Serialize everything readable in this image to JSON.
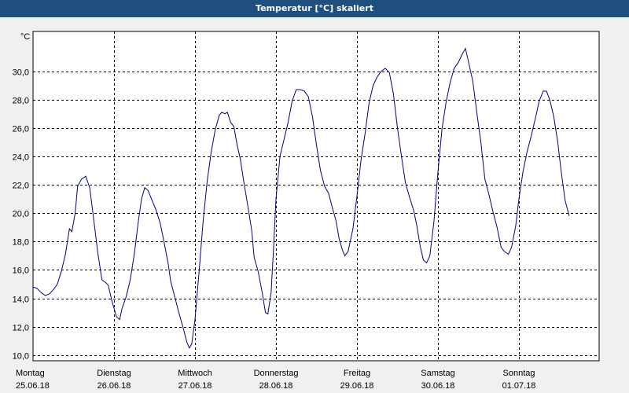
{
  "window": {
    "title": "Temperatur [°C] skaliert"
  },
  "chart_data": {
    "type": "line",
    "title": "Temperatur [°C] skaliert",
    "ylabel": "°C",
    "xlabel": "",
    "ylim": [
      9.6,
      32.8
    ],
    "yticks": [
      "10,0",
      "12,0",
      "14,0",
      "16,0",
      "18,0",
      "20,0",
      "22,0",
      "24,0",
      "26,0",
      "28,0",
      "30,0"
    ],
    "x_range_days": [
      0,
      7
    ],
    "x_categories": [
      {
        "day": "Montag",
        "date": "25.06.18"
      },
      {
        "day": "Dienstag",
        "date": "26.06.18"
      },
      {
        "day": "Mittwoch",
        "date": "27.06.18"
      },
      {
        "day": "Donnerstag",
        "date": "28.06.18"
      },
      {
        "day": "Freitag",
        "date": "29.06.18"
      },
      {
        "day": "Samstag",
        "date": "30.06.18"
      },
      {
        "day": "Sonntag",
        "date": "01.07.18"
      }
    ],
    "grid": true,
    "series": [
      {
        "color": "#00008b",
        "points": [
          [
            0.0,
            14.8
          ],
          [
            0.05,
            14.7
          ],
          [
            0.1,
            14.4
          ],
          [
            0.15,
            14.2
          ],
          [
            0.2,
            14.3
          ],
          [
            0.25,
            14.6
          ],
          [
            0.3,
            15.0
          ],
          [
            0.35,
            15.9
          ],
          [
            0.4,
            17.1
          ],
          [
            0.45,
            18.9
          ],
          [
            0.48,
            18.7
          ],
          [
            0.52,
            20.0
          ],
          [
            0.55,
            21.9
          ],
          [
            0.6,
            22.4
          ],
          [
            0.65,
            22.6
          ],
          [
            0.7,
            21.8
          ],
          [
            0.75,
            19.5
          ],
          [
            0.8,
            17.2
          ],
          [
            0.85,
            15.3
          ],
          [
            0.9,
            15.1
          ],
          [
            0.93,
            14.9
          ],
          [
            0.97,
            13.9
          ],
          [
            1.0,
            13.3
          ],
          [
            1.03,
            12.7
          ],
          [
            1.07,
            12.5
          ],
          [
            1.1,
            13.3
          ],
          [
            1.15,
            14.1
          ],
          [
            1.2,
            15.3
          ],
          [
            1.25,
            17.1
          ],
          [
            1.3,
            19.4
          ],
          [
            1.34,
            21.0
          ],
          [
            1.38,
            21.8
          ],
          [
            1.42,
            21.6
          ],
          [
            1.47,
            20.9
          ],
          [
            1.52,
            20.2
          ],
          [
            1.57,
            19.3
          ],
          [
            1.62,
            17.9
          ],
          [
            1.67,
            16.4
          ],
          [
            1.7,
            15.2
          ],
          [
            1.75,
            14.1
          ],
          [
            1.8,
            13.0
          ],
          [
            1.85,
            12.0
          ],
          [
            1.9,
            10.9
          ],
          [
            1.93,
            10.5
          ],
          [
            1.96,
            10.8
          ],
          [
            2.0,
            12.5
          ],
          [
            2.05,
            15.8
          ],
          [
            2.1,
            19.4
          ],
          [
            2.15,
            22.2
          ],
          [
            2.2,
            24.3
          ],
          [
            2.25,
            25.9
          ],
          [
            2.3,
            26.9
          ],
          [
            2.33,
            27.1
          ],
          [
            2.37,
            27.0
          ],
          [
            2.4,
            27.1
          ],
          [
            2.44,
            26.4
          ],
          [
            2.48,
            26.1
          ],
          [
            2.52,
            24.8
          ],
          [
            2.56,
            23.8
          ],
          [
            2.6,
            22.3
          ],
          [
            2.65,
            20.6
          ],
          [
            2.7,
            18.8
          ],
          [
            2.73,
            16.9
          ],
          [
            2.78,
            15.9
          ],
          [
            2.83,
            14.4
          ],
          [
            2.87,
            13.0
          ],
          [
            2.9,
            12.9
          ],
          [
            2.94,
            14.4
          ],
          [
            2.97,
            17.5
          ],
          [
            3.0,
            21.0
          ],
          [
            3.05,
            24.0
          ],
          [
            3.1,
            25.2
          ],
          [
            3.15,
            26.4
          ],
          [
            3.2,
            27.9
          ],
          [
            3.25,
            28.7
          ],
          [
            3.3,
            28.7
          ],
          [
            3.35,
            28.6
          ],
          [
            3.4,
            28.2
          ],
          [
            3.45,
            26.8
          ],
          [
            3.5,
            24.8
          ],
          [
            3.55,
            23.0
          ],
          [
            3.6,
            21.9
          ],
          [
            3.65,
            21.4
          ],
          [
            3.7,
            20.3
          ],
          [
            3.74,
            19.5
          ],
          [
            3.78,
            18.2
          ],
          [
            3.82,
            17.4
          ],
          [
            3.85,
            17.0
          ],
          [
            3.89,
            17.3
          ],
          [
            3.95,
            18.9
          ],
          [
            4.0,
            21.2
          ],
          [
            4.05,
            23.7
          ],
          [
            4.1,
            25.6
          ],
          [
            4.15,
            27.8
          ],
          [
            4.2,
            29.0
          ],
          [
            4.25,
            29.6
          ],
          [
            4.3,
            30.0
          ],
          [
            4.35,
            30.2
          ],
          [
            4.4,
            29.9
          ],
          [
            4.45,
            28.4
          ],
          [
            4.5,
            26.0
          ],
          [
            4.55,
            24.0
          ],
          [
            4.6,
            22.1
          ],
          [
            4.65,
            21.1
          ],
          [
            4.7,
            20.2
          ],
          [
            4.74,
            19.1
          ],
          [
            4.78,
            17.7
          ],
          [
            4.82,
            16.7
          ],
          [
            4.86,
            16.5
          ],
          [
            4.9,
            17.0
          ],
          [
            4.95,
            19.4
          ],
          [
            5.0,
            22.9
          ],
          [
            5.05,
            25.9
          ],
          [
            5.1,
            27.8
          ],
          [
            5.15,
            29.2
          ],
          [
            5.2,
            30.2
          ],
          [
            5.25,
            30.6
          ],
          [
            5.3,
            31.2
          ],
          [
            5.34,
            31.6
          ],
          [
            5.38,
            30.6
          ],
          [
            5.43,
            29.3
          ],
          [
            5.48,
            27.1
          ],
          [
            5.53,
            25.0
          ],
          [
            5.58,
            22.4
          ],
          [
            5.63,
            21.3
          ],
          [
            5.68,
            20.1
          ],
          [
            5.73,
            19.0
          ],
          [
            5.78,
            17.6
          ],
          [
            5.82,
            17.3
          ],
          [
            5.87,
            17.1
          ],
          [
            5.91,
            17.6
          ],
          [
            5.96,
            19.1
          ],
          [
            6.0,
            21.0
          ],
          [
            6.05,
            22.9
          ],
          [
            6.1,
            24.3
          ],
          [
            6.15,
            25.4
          ],
          [
            6.2,
            26.6
          ],
          [
            6.25,
            27.9
          ],
          [
            6.3,
            28.6
          ],
          [
            6.34,
            28.6
          ],
          [
            6.38,
            28.0
          ],
          [
            6.43,
            26.8
          ],
          [
            6.48,
            25.0
          ],
          [
            6.52,
            23.0
          ],
          [
            6.57,
            20.9
          ],
          [
            6.62,
            19.8
          ]
        ]
      }
    ]
  }
}
